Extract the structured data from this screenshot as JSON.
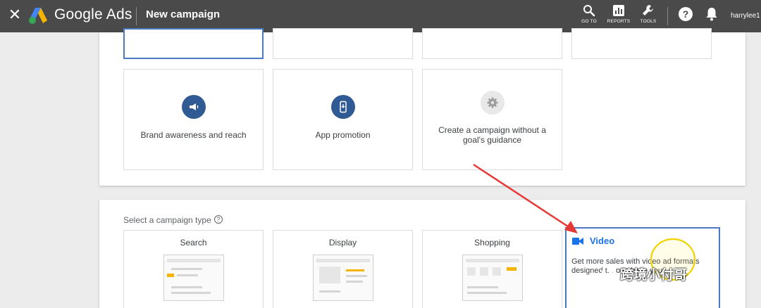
{
  "topbar": {
    "close_icon": "close-icon",
    "brand": "Google Ads",
    "page_title": "New campaign",
    "tools": [
      {
        "icon": "search-icon",
        "label": "GO TO"
      },
      {
        "icon": "reports-icon",
        "label": "REPORTS"
      },
      {
        "icon": "wrench-icon",
        "label": "TOOLS"
      }
    ],
    "help": "?",
    "user": "harrylee1"
  },
  "goals": {
    "cards": [
      {
        "label": "Brand awareness and reach",
        "icon": "megaphone-icon"
      },
      {
        "label": "App promotion",
        "icon": "phone-icon"
      },
      {
        "label": "Create a campaign without a goal's guidance",
        "icon": "gear-icon"
      }
    ]
  },
  "types": {
    "select_label": "Select a campaign type",
    "help_icon": "?",
    "cards": [
      {
        "label": "Search"
      },
      {
        "label": "Display"
      },
      {
        "label": "Shopping"
      },
      {
        "label": "Video",
        "desc": "Get more sales with video ad formats designed t... purchase your..."
      }
    ]
  },
  "watermark": "跨境小付哥",
  "colors": {
    "topbar": "#4a4a4a",
    "accent": "#1a73e8",
    "icon_circle": "#2f5a93",
    "arrow": "#e53935",
    "highlight": "#f2d200"
  }
}
